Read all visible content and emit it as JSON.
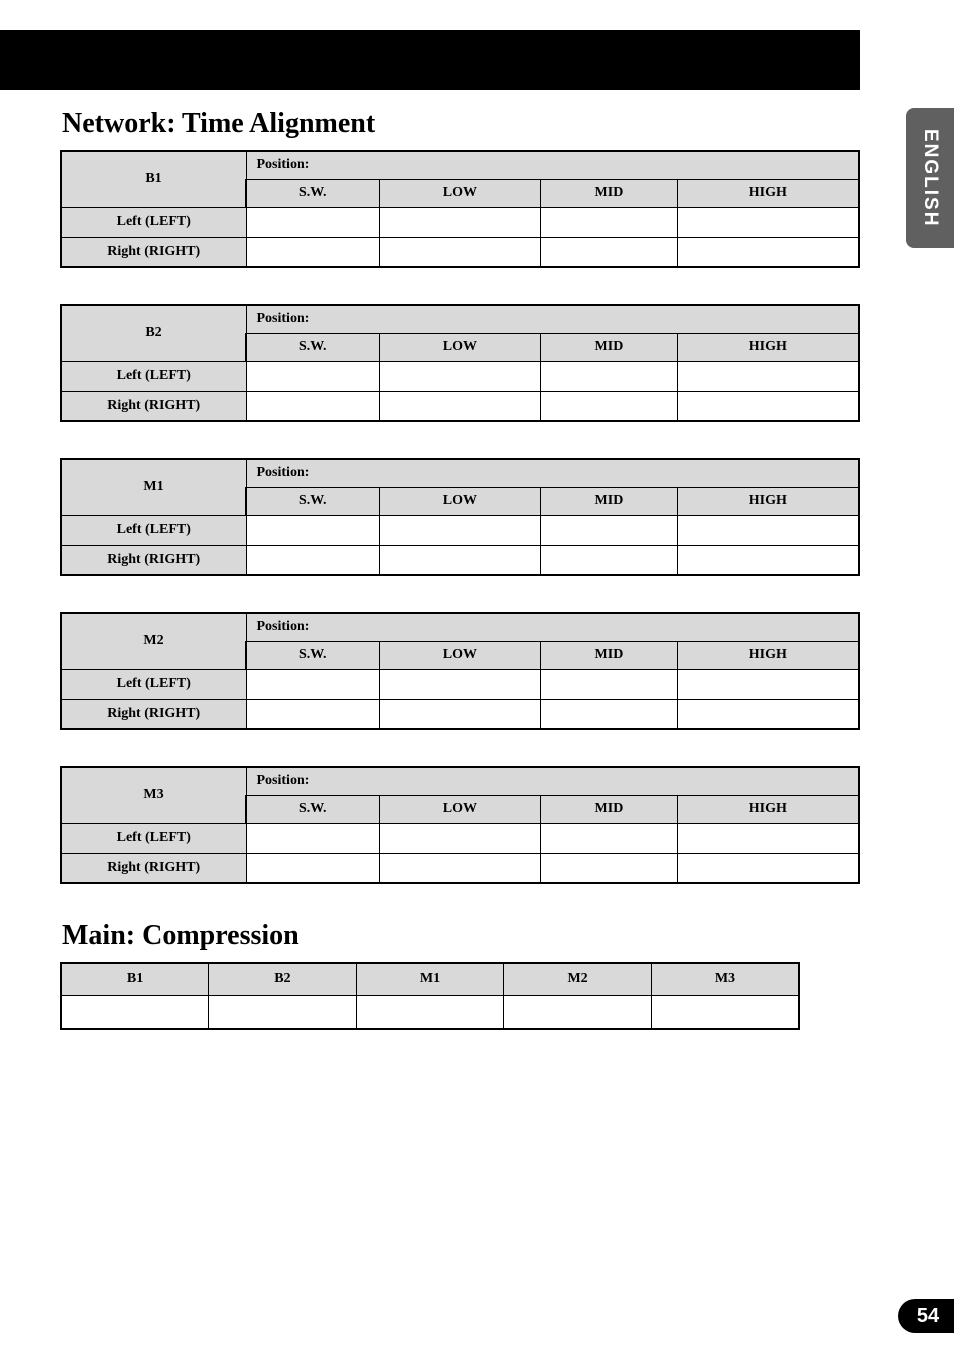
{
  "sideTab": "ENGLISH",
  "pageNumber": "54",
  "section1": {
    "title": "Network: Time Alignment",
    "tables": [
      {
        "id": "B1",
        "positionLabel": "Position:",
        "cols": [
          "S.W.",
          "LOW",
          "MID",
          "HIGH"
        ],
        "rows": [
          "Left (LEFT)",
          "Right (RIGHT)"
        ]
      },
      {
        "id": "B2",
        "positionLabel": "Position:",
        "cols": [
          "S.W.",
          "LOW",
          "MID",
          "HIGH"
        ],
        "rows": [
          "Left (LEFT)",
          "Right (RIGHT)"
        ]
      },
      {
        "id": "M1",
        "positionLabel": "Position:",
        "cols": [
          "S.W.",
          "LOW",
          "MID",
          "HIGH"
        ],
        "rows": [
          "Left (LEFT)",
          "Right (RIGHT)"
        ]
      },
      {
        "id": "M2",
        "positionLabel": "Position:",
        "cols": [
          "S.W.",
          "LOW",
          "MID",
          "HIGH"
        ],
        "rows": [
          "Left (LEFT)",
          "Right (RIGHT)"
        ]
      },
      {
        "id": "M3",
        "positionLabel": "Position:",
        "cols": [
          "S.W.",
          "LOW",
          "MID",
          "HIGH"
        ],
        "rows": [
          "Left (LEFT)",
          "Right (RIGHT)"
        ]
      }
    ]
  },
  "section2": {
    "title": "Main: Compression",
    "cols": [
      "B1",
      "B2",
      "M1",
      "M2",
      "M3"
    ]
  }
}
